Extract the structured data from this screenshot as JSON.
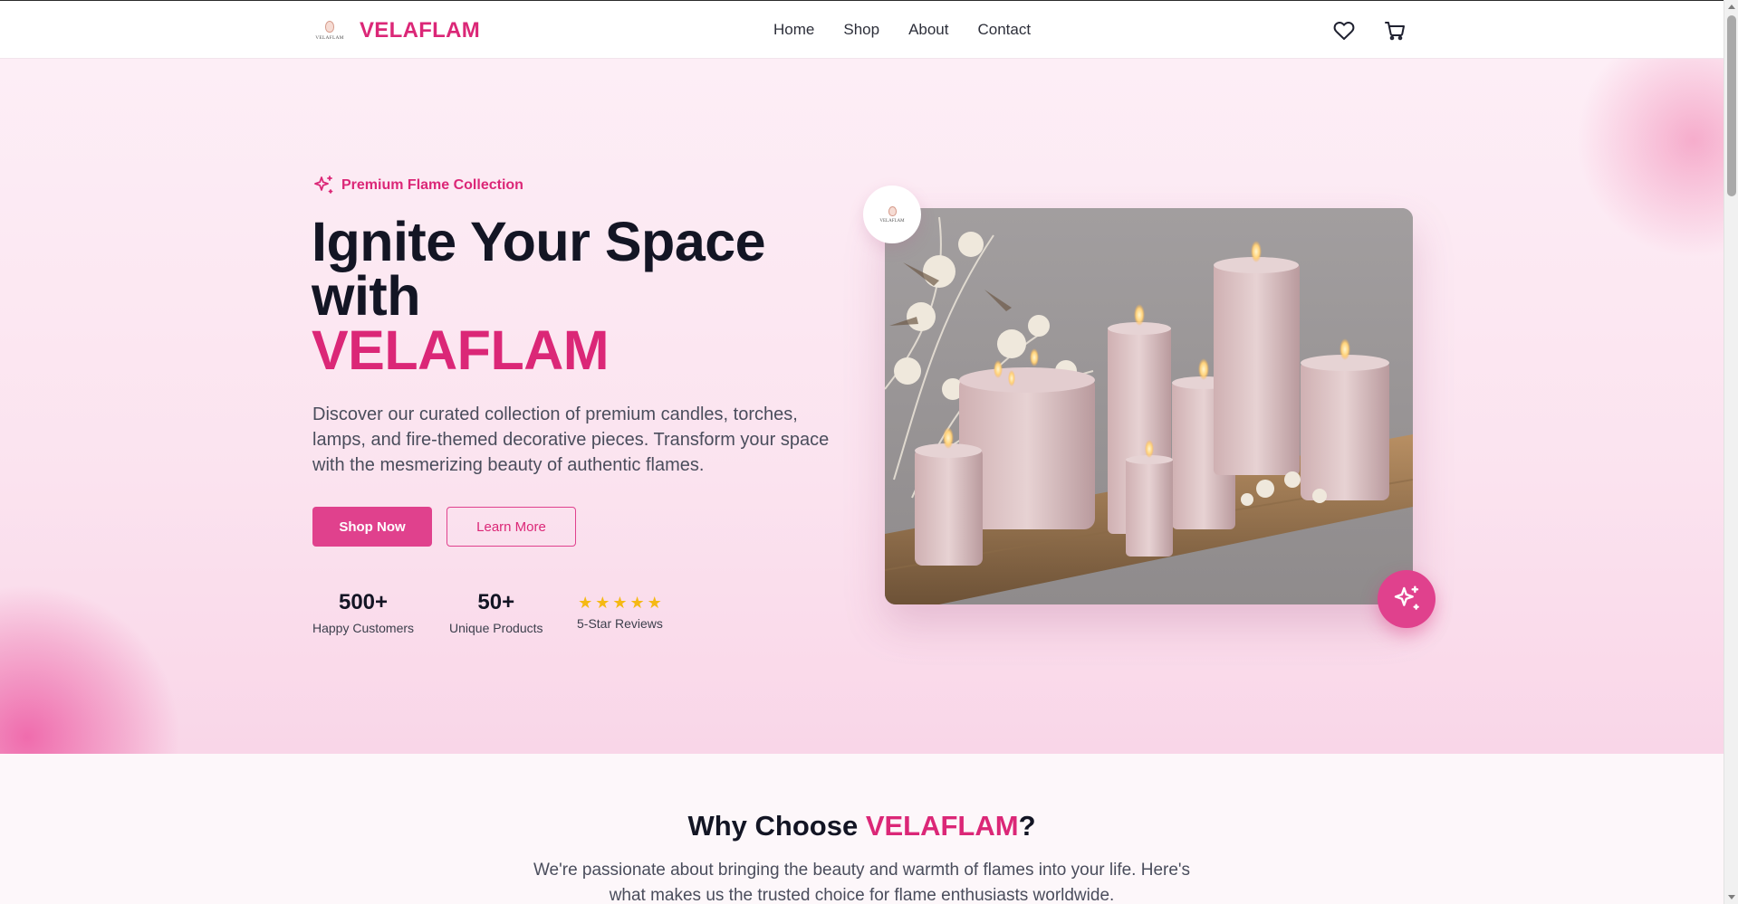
{
  "brand": {
    "name": "VELAFLAM",
    "logo_text": "VELAFLAM"
  },
  "nav": {
    "items": [
      "Home",
      "Shop",
      "About",
      "Contact"
    ]
  },
  "header_icons": [
    "heart-icon",
    "cart-icon"
  ],
  "hero": {
    "badge": "Premium Flame Collection",
    "title_line1": "Ignite Your Space",
    "title_line2": "with",
    "title_accent": "VELAFLAM",
    "description": "Discover our curated collection of premium candles, torches, lamps, and fire-themed decorative pieces. Transform your space with the mesmerizing beauty of authentic flames.",
    "primary_button": "Shop Now",
    "secondary_button": "Learn More",
    "stats": [
      {
        "value": "500+",
        "label": "Happy Customers"
      },
      {
        "value": "50+",
        "label": "Unique Products"
      }
    ],
    "reviews": {
      "stars": 5,
      "label": "5-Star Reviews"
    },
    "image_logo_text": "VELAFLAM"
  },
  "why": {
    "title_pre": "Why Choose ",
    "title_accent": "VELAFLAM",
    "title_post": "?",
    "description": "We're passionate about bringing the beauty and warmth of flames into your life. Here's what makes us the trusted choice for flame enthusiasts worldwide."
  },
  "colors": {
    "accent": "#db2777",
    "button": "#e0418d",
    "star": "#f5b914",
    "hero_bg": "#fbe3ef",
    "text_dark": "#131524"
  }
}
